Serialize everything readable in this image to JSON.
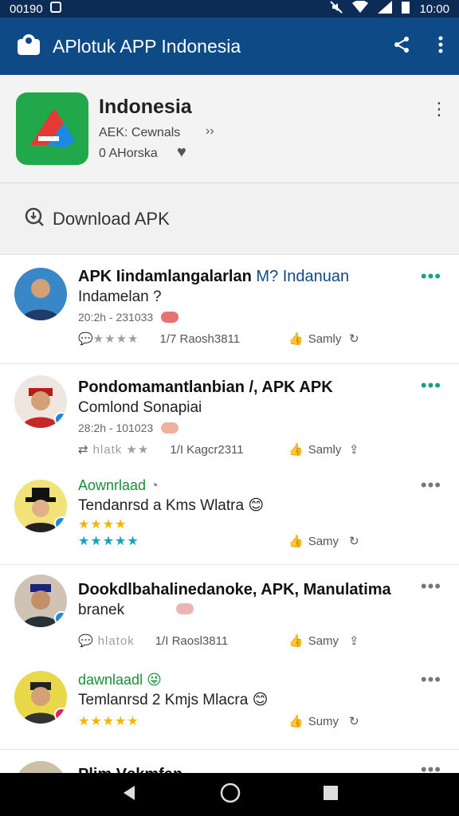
{
  "status": {
    "left_text": "00190",
    "time": "10:00"
  },
  "app_bar": {
    "title": "APlotuk APP Indonesia"
  },
  "header": {
    "name": "Indonesia",
    "line1": "AEK: Cewnals",
    "line2": "0 AHorska",
    "chev": "››"
  },
  "download": {
    "label": "Download APK"
  },
  "items": [
    {
      "headline": "APK Iindamlangalarlan",
      "accent": "M? Indanuan",
      "subline": "Indamelan ?",
      "meta": "20:2h - 231033",
      "stars_text": "★★★★",
      "count": "1/7 Raosh3811",
      "like": "Samly"
    },
    {
      "headline": "Pondomamantlanbian /, APK APK",
      "subline": "Comlond Sonapiai",
      "meta": "28:2h - 101023",
      "stars_text": "hlatk ★★",
      "count": "1/I Kagcr2311",
      "like": "Samly"
    },
    {
      "headline": "Aownrlaad",
      "subline": "Tendanrsd a Kms Wlatra",
      "like": "Samy"
    },
    {
      "headline": "Dookdlbahalinedanoke, APK, Manulatima",
      "subline": "branek",
      "stars_text": "hlatok",
      "count": "1/I Raosl3811",
      "like": "Samy"
    },
    {
      "headline": "dawnlaadl",
      "subline": "Temlanrsd 2 Kmjs Mlacra",
      "like": "Sumy"
    }
  ],
  "partial_item": {
    "headline": "Plim Vskmfan"
  }
}
